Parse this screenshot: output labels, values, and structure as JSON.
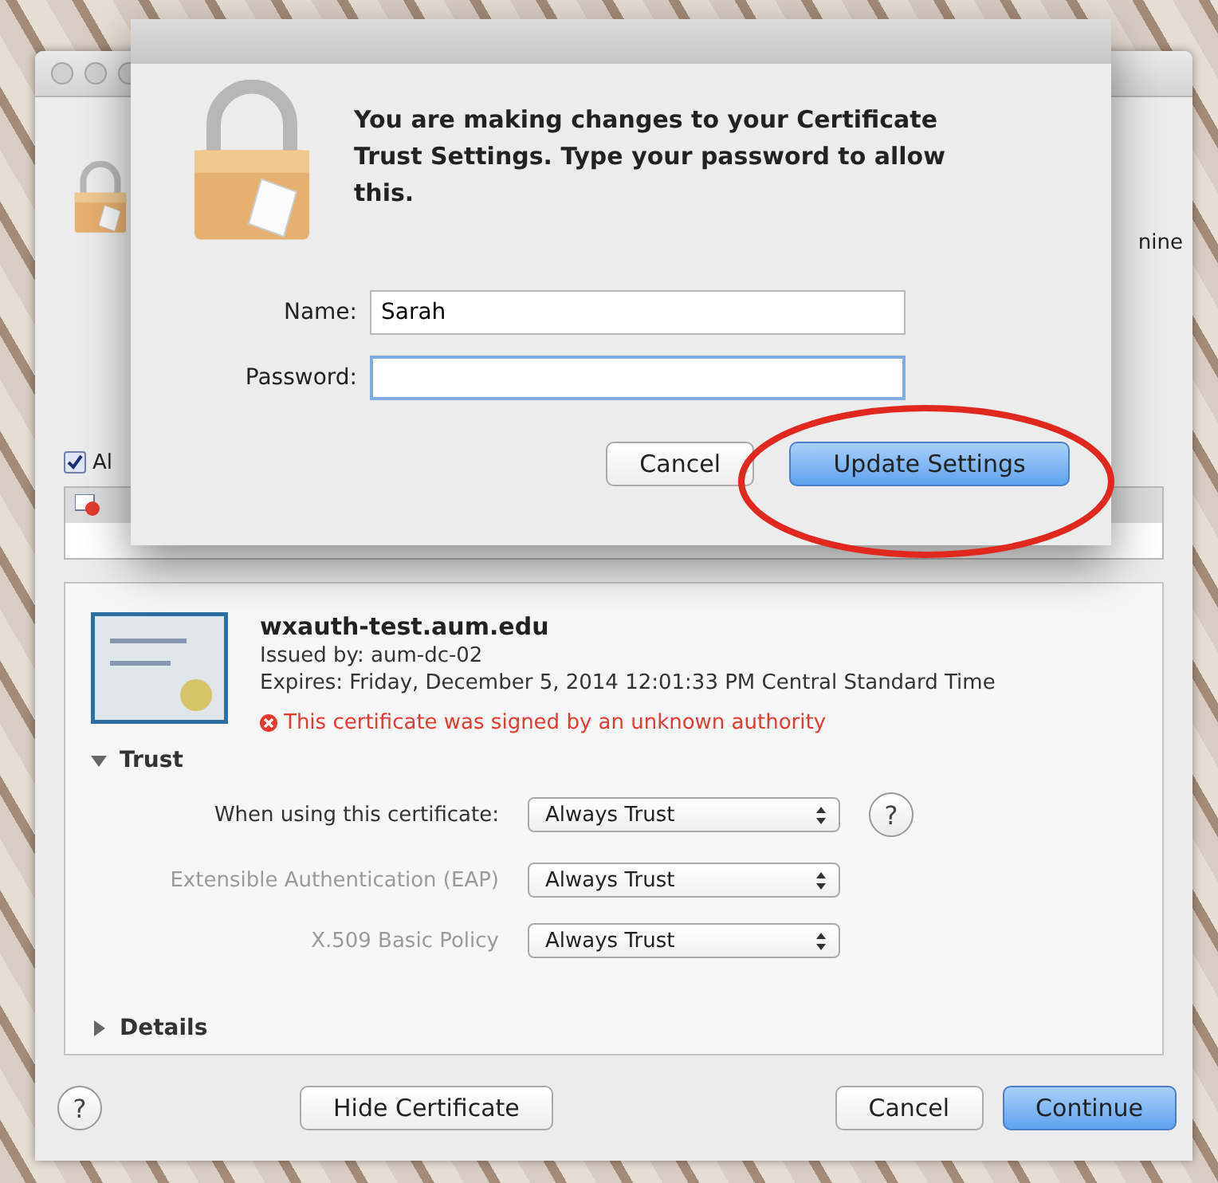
{
  "background_window": {
    "partial_text": "nine",
    "checkbox": {
      "label": "Al",
      "checked": true
    },
    "certificate": {
      "name": "wxauth-test.aum.edu",
      "issued_by": "Issued by: aum-dc-02",
      "expires": "Expires: Friday, December 5, 2014 12:01:33 PM Central Standard Time",
      "error": "This certificate was signed by an unknown authority"
    },
    "sections": [
      {
        "title": "Trust",
        "expanded": true,
        "rows": [
          {
            "label": "When using this certificate:",
            "value": "Always Trust",
            "disabled": false,
            "help": "?"
          },
          {
            "label": "Extensible Authentication (EAP)",
            "value": "Always Trust",
            "disabled": true
          },
          {
            "label": "X.509 Basic Policy",
            "value": "Always Trust",
            "disabled": true
          }
        ]
      },
      {
        "title": "Details",
        "expanded": false
      }
    ],
    "help_button": "?",
    "buttons": [
      {
        "label": "Hide Certificate",
        "default": false
      },
      {
        "label": "Cancel",
        "default": false
      },
      {
        "label": "Continue",
        "default": true
      }
    ]
  },
  "sheet": {
    "message": "You are making changes to your Certificate Trust Settings. Type your password to allow this.",
    "fields": [
      {
        "label": "Name:",
        "value": "Sarah",
        "focused": false
      },
      {
        "label": "Password:",
        "focused": true
      }
    ],
    "buttons": [
      {
        "label": "Cancel",
        "default": false
      },
      {
        "label": "Update Settings",
        "default": true
      }
    ]
  },
  "annotation": {
    "kind": "ellipse"
  }
}
